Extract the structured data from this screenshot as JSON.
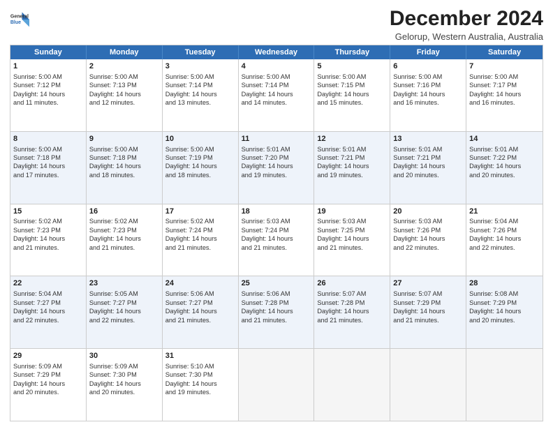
{
  "logo": {
    "line1": "General",
    "line2": "Blue"
  },
  "title": "December 2024",
  "subtitle": "Gelorup, Western Australia, Australia",
  "columns": [
    "Sunday",
    "Monday",
    "Tuesday",
    "Wednesday",
    "Thursday",
    "Friday",
    "Saturday"
  ],
  "weeks": [
    [
      {
        "num": "1",
        "lines": [
          "Sunrise: 5:00 AM",
          "Sunset: 7:12 PM",
          "Daylight: 14 hours",
          "and 11 minutes."
        ]
      },
      {
        "num": "2",
        "lines": [
          "Sunrise: 5:00 AM",
          "Sunset: 7:13 PM",
          "Daylight: 14 hours",
          "and 12 minutes."
        ]
      },
      {
        "num": "3",
        "lines": [
          "Sunrise: 5:00 AM",
          "Sunset: 7:14 PM",
          "Daylight: 14 hours",
          "and 13 minutes."
        ]
      },
      {
        "num": "4",
        "lines": [
          "Sunrise: 5:00 AM",
          "Sunset: 7:14 PM",
          "Daylight: 14 hours",
          "and 14 minutes."
        ]
      },
      {
        "num": "5",
        "lines": [
          "Sunrise: 5:00 AM",
          "Sunset: 7:15 PM",
          "Daylight: 14 hours",
          "and 15 minutes."
        ]
      },
      {
        "num": "6",
        "lines": [
          "Sunrise: 5:00 AM",
          "Sunset: 7:16 PM",
          "Daylight: 14 hours",
          "and 16 minutes."
        ]
      },
      {
        "num": "7",
        "lines": [
          "Sunrise: 5:00 AM",
          "Sunset: 7:17 PM",
          "Daylight: 14 hours",
          "and 16 minutes."
        ]
      }
    ],
    [
      {
        "num": "8",
        "lines": [
          "Sunrise: 5:00 AM",
          "Sunset: 7:18 PM",
          "Daylight: 14 hours",
          "and 17 minutes."
        ]
      },
      {
        "num": "9",
        "lines": [
          "Sunrise: 5:00 AM",
          "Sunset: 7:18 PM",
          "Daylight: 14 hours",
          "and 18 minutes."
        ]
      },
      {
        "num": "10",
        "lines": [
          "Sunrise: 5:00 AM",
          "Sunset: 7:19 PM",
          "Daylight: 14 hours",
          "and 18 minutes."
        ]
      },
      {
        "num": "11",
        "lines": [
          "Sunrise: 5:01 AM",
          "Sunset: 7:20 PM",
          "Daylight: 14 hours",
          "and 19 minutes."
        ]
      },
      {
        "num": "12",
        "lines": [
          "Sunrise: 5:01 AM",
          "Sunset: 7:21 PM",
          "Daylight: 14 hours",
          "and 19 minutes."
        ]
      },
      {
        "num": "13",
        "lines": [
          "Sunrise: 5:01 AM",
          "Sunset: 7:21 PM",
          "Daylight: 14 hours",
          "and 20 minutes."
        ]
      },
      {
        "num": "14",
        "lines": [
          "Sunrise: 5:01 AM",
          "Sunset: 7:22 PM",
          "Daylight: 14 hours",
          "and 20 minutes."
        ]
      }
    ],
    [
      {
        "num": "15",
        "lines": [
          "Sunrise: 5:02 AM",
          "Sunset: 7:23 PM",
          "Daylight: 14 hours",
          "and 21 minutes."
        ]
      },
      {
        "num": "16",
        "lines": [
          "Sunrise: 5:02 AM",
          "Sunset: 7:23 PM",
          "Daylight: 14 hours",
          "and 21 minutes."
        ]
      },
      {
        "num": "17",
        "lines": [
          "Sunrise: 5:02 AM",
          "Sunset: 7:24 PM",
          "Daylight: 14 hours",
          "and 21 minutes."
        ]
      },
      {
        "num": "18",
        "lines": [
          "Sunrise: 5:03 AM",
          "Sunset: 7:24 PM",
          "Daylight: 14 hours",
          "and 21 minutes."
        ]
      },
      {
        "num": "19",
        "lines": [
          "Sunrise: 5:03 AM",
          "Sunset: 7:25 PM",
          "Daylight: 14 hours",
          "and 21 minutes."
        ]
      },
      {
        "num": "20",
        "lines": [
          "Sunrise: 5:03 AM",
          "Sunset: 7:26 PM",
          "Daylight: 14 hours",
          "and 22 minutes."
        ]
      },
      {
        "num": "21",
        "lines": [
          "Sunrise: 5:04 AM",
          "Sunset: 7:26 PM",
          "Daylight: 14 hours",
          "and 22 minutes."
        ]
      }
    ],
    [
      {
        "num": "22",
        "lines": [
          "Sunrise: 5:04 AM",
          "Sunset: 7:27 PM",
          "Daylight: 14 hours",
          "and 22 minutes."
        ]
      },
      {
        "num": "23",
        "lines": [
          "Sunrise: 5:05 AM",
          "Sunset: 7:27 PM",
          "Daylight: 14 hours",
          "and 22 minutes."
        ]
      },
      {
        "num": "24",
        "lines": [
          "Sunrise: 5:06 AM",
          "Sunset: 7:27 PM",
          "Daylight: 14 hours",
          "and 21 minutes."
        ]
      },
      {
        "num": "25",
        "lines": [
          "Sunrise: 5:06 AM",
          "Sunset: 7:28 PM",
          "Daylight: 14 hours",
          "and 21 minutes."
        ]
      },
      {
        "num": "26",
        "lines": [
          "Sunrise: 5:07 AM",
          "Sunset: 7:28 PM",
          "Daylight: 14 hours",
          "and 21 minutes."
        ]
      },
      {
        "num": "27",
        "lines": [
          "Sunrise: 5:07 AM",
          "Sunset: 7:29 PM",
          "Daylight: 14 hours",
          "and 21 minutes."
        ]
      },
      {
        "num": "28",
        "lines": [
          "Sunrise: 5:08 AM",
          "Sunset: 7:29 PM",
          "Daylight: 14 hours",
          "and 20 minutes."
        ]
      }
    ],
    [
      {
        "num": "29",
        "lines": [
          "Sunrise: 5:09 AM",
          "Sunset: 7:29 PM",
          "Daylight: 14 hours",
          "and 20 minutes."
        ]
      },
      {
        "num": "30",
        "lines": [
          "Sunrise: 5:09 AM",
          "Sunset: 7:30 PM",
          "Daylight: 14 hours",
          "and 20 minutes."
        ]
      },
      {
        "num": "31",
        "lines": [
          "Sunrise: 5:10 AM",
          "Sunset: 7:30 PM",
          "Daylight: 14 hours",
          "and 19 minutes."
        ]
      },
      {
        "num": "",
        "lines": []
      },
      {
        "num": "",
        "lines": []
      },
      {
        "num": "",
        "lines": []
      },
      {
        "num": "",
        "lines": []
      }
    ]
  ]
}
